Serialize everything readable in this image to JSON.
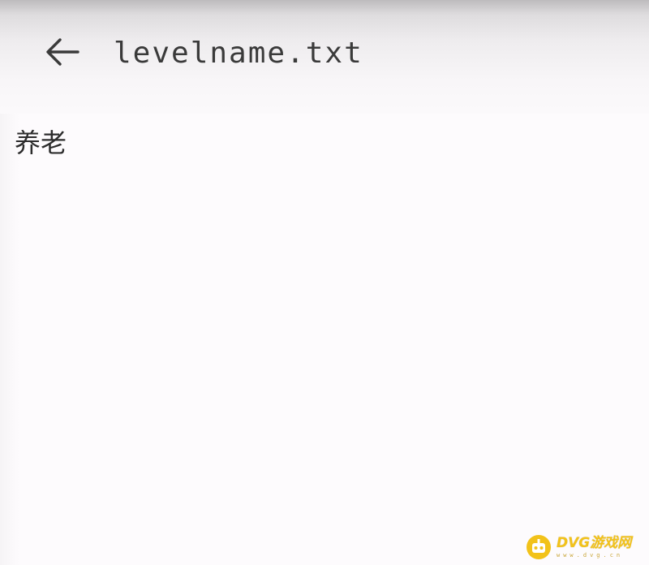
{
  "app_bar": {
    "back_icon": "arrow-left-icon",
    "title": "levelname.txt"
  },
  "content": {
    "text": "养老"
  },
  "watermark": {
    "logo_icon": "gamepad-robot-icon",
    "text": "DVG游戏网",
    "subtext": "www.dvg.cn",
    "color": "#f2c21a"
  },
  "colors": {
    "background": "#fdfbfd",
    "text": "#2c2c2c",
    "title_text": "#3a3a3a"
  }
}
